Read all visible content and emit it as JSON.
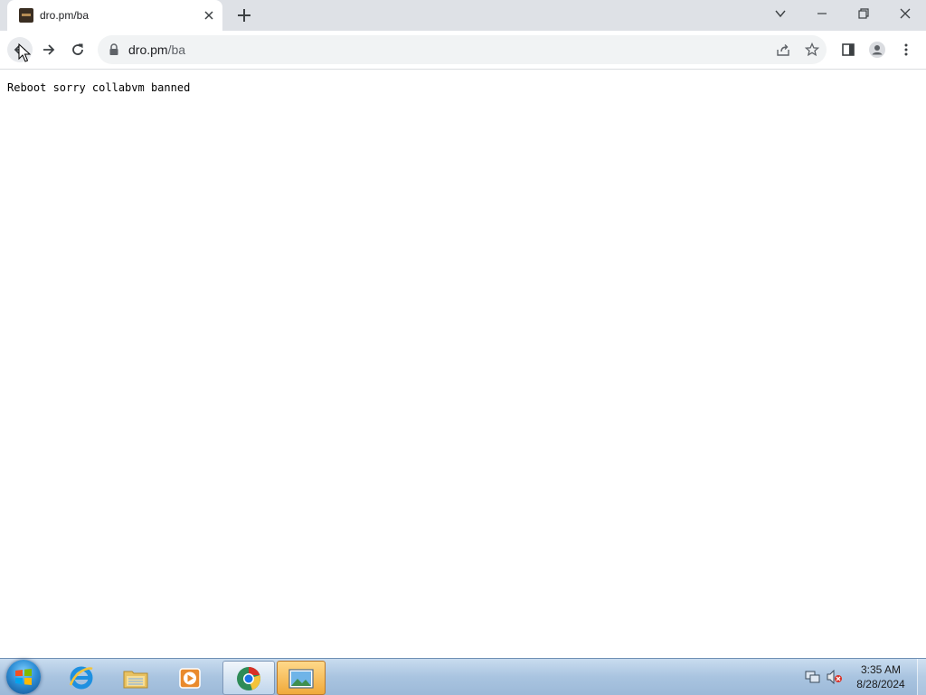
{
  "browser": {
    "tab": {
      "title": "dro.pm/ba",
      "favicon": "site-favicon"
    },
    "omnibox": {
      "host": "dro.pm",
      "path": "/ba"
    }
  },
  "page": {
    "text": "Reboot sorry collabvm banned"
  },
  "taskbar": {
    "apps": [
      "internet-explorer",
      "windows-explorer",
      "media-player",
      "chrome",
      "photo-viewer"
    ],
    "clock": {
      "time": "3:35 AM",
      "date": "8/28/2024"
    }
  }
}
